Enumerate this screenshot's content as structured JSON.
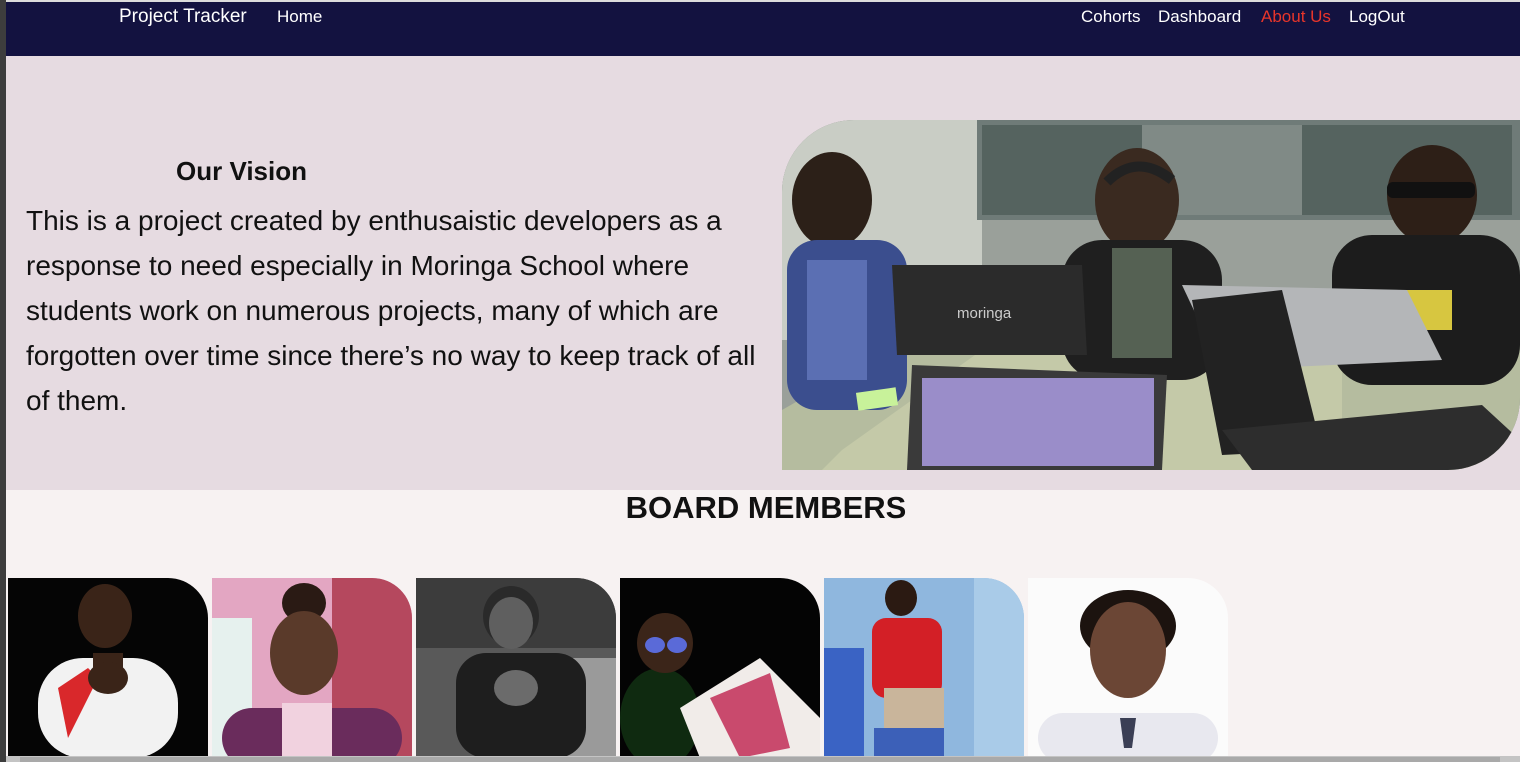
{
  "navbar": {
    "brand": "Project Tracker",
    "links": [
      {
        "label": "Home"
      },
      {
        "label": "Cohorts"
      },
      {
        "label": "Dashboard"
      },
      {
        "label": "About Us",
        "active": true
      },
      {
        "label": "LogOut"
      }
    ],
    "background_color": "#131240",
    "active_color": "#e8352a"
  },
  "vision": {
    "title": "Our Vision",
    "text": "This is a project created by enthusaistic developers as a response to need especially in Moringa School where students work on numerous projects, many of which are forgotten over time since there’s no way to keep track of all of them.",
    "image_icon": "team-photo",
    "laptop_logo": "moringa",
    "background_color": "#e6dbe1"
  },
  "board": {
    "title": "BOARD MEMBERS",
    "members": [
      {
        "photo_icon": "member-photo-1"
      },
      {
        "photo_icon": "member-photo-2"
      },
      {
        "photo_icon": "member-photo-3"
      },
      {
        "photo_icon": "member-photo-4"
      },
      {
        "photo_icon": "member-photo-5"
      },
      {
        "photo_icon": "member-photo-6"
      }
    ]
  }
}
